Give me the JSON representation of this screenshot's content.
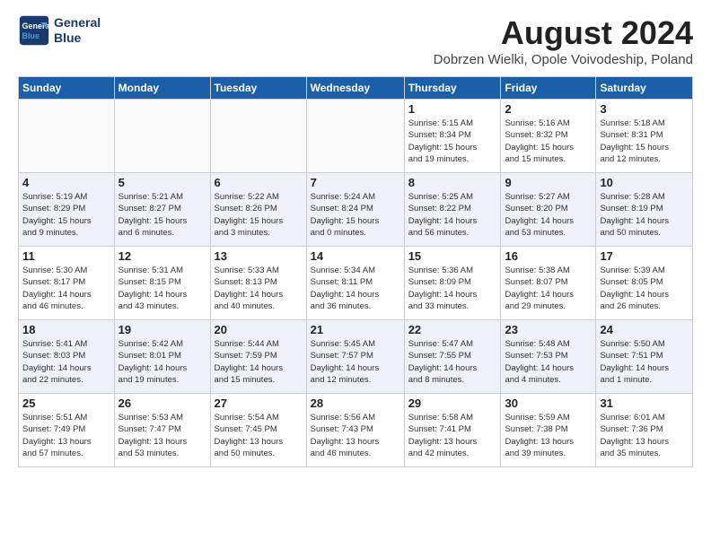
{
  "logo": {
    "line1": "General",
    "line2": "Blue"
  },
  "title": "August 2024",
  "location": "Dobrzen Wielki, Opole Voivodeship, Poland",
  "headers": [
    "Sunday",
    "Monday",
    "Tuesday",
    "Wednesday",
    "Thursday",
    "Friday",
    "Saturday"
  ],
  "weeks": [
    [
      {
        "day": "",
        "info": ""
      },
      {
        "day": "",
        "info": ""
      },
      {
        "day": "",
        "info": ""
      },
      {
        "day": "",
        "info": ""
      },
      {
        "day": "1",
        "info": "Sunrise: 5:15 AM\nSunset: 8:34 PM\nDaylight: 15 hours\nand 19 minutes."
      },
      {
        "day": "2",
        "info": "Sunrise: 5:16 AM\nSunset: 8:32 PM\nDaylight: 15 hours\nand 15 minutes."
      },
      {
        "day": "3",
        "info": "Sunrise: 5:18 AM\nSunset: 8:31 PM\nDaylight: 15 hours\nand 12 minutes."
      }
    ],
    [
      {
        "day": "4",
        "info": "Sunrise: 5:19 AM\nSunset: 8:29 PM\nDaylight: 15 hours\nand 9 minutes."
      },
      {
        "day": "5",
        "info": "Sunrise: 5:21 AM\nSunset: 8:27 PM\nDaylight: 15 hours\nand 6 minutes."
      },
      {
        "day": "6",
        "info": "Sunrise: 5:22 AM\nSunset: 8:26 PM\nDaylight: 15 hours\nand 3 minutes."
      },
      {
        "day": "7",
        "info": "Sunrise: 5:24 AM\nSunset: 8:24 PM\nDaylight: 15 hours\nand 0 minutes."
      },
      {
        "day": "8",
        "info": "Sunrise: 5:25 AM\nSunset: 8:22 PM\nDaylight: 14 hours\nand 56 minutes."
      },
      {
        "day": "9",
        "info": "Sunrise: 5:27 AM\nSunset: 8:20 PM\nDaylight: 14 hours\nand 53 minutes."
      },
      {
        "day": "10",
        "info": "Sunrise: 5:28 AM\nSunset: 8:19 PM\nDaylight: 14 hours\nand 50 minutes."
      }
    ],
    [
      {
        "day": "11",
        "info": "Sunrise: 5:30 AM\nSunset: 8:17 PM\nDaylight: 14 hours\nand 46 minutes."
      },
      {
        "day": "12",
        "info": "Sunrise: 5:31 AM\nSunset: 8:15 PM\nDaylight: 14 hours\nand 43 minutes."
      },
      {
        "day": "13",
        "info": "Sunrise: 5:33 AM\nSunset: 8:13 PM\nDaylight: 14 hours\nand 40 minutes."
      },
      {
        "day": "14",
        "info": "Sunrise: 5:34 AM\nSunset: 8:11 PM\nDaylight: 14 hours\nand 36 minutes."
      },
      {
        "day": "15",
        "info": "Sunrise: 5:36 AM\nSunset: 8:09 PM\nDaylight: 14 hours\nand 33 minutes."
      },
      {
        "day": "16",
        "info": "Sunrise: 5:38 AM\nSunset: 8:07 PM\nDaylight: 14 hours\nand 29 minutes."
      },
      {
        "day": "17",
        "info": "Sunrise: 5:39 AM\nSunset: 8:05 PM\nDaylight: 14 hours\nand 26 minutes."
      }
    ],
    [
      {
        "day": "18",
        "info": "Sunrise: 5:41 AM\nSunset: 8:03 PM\nDaylight: 14 hours\nand 22 minutes."
      },
      {
        "day": "19",
        "info": "Sunrise: 5:42 AM\nSunset: 8:01 PM\nDaylight: 14 hours\nand 19 minutes."
      },
      {
        "day": "20",
        "info": "Sunrise: 5:44 AM\nSunset: 7:59 PM\nDaylight: 14 hours\nand 15 minutes."
      },
      {
        "day": "21",
        "info": "Sunrise: 5:45 AM\nSunset: 7:57 PM\nDaylight: 14 hours\nand 12 minutes."
      },
      {
        "day": "22",
        "info": "Sunrise: 5:47 AM\nSunset: 7:55 PM\nDaylight: 14 hours\nand 8 minutes."
      },
      {
        "day": "23",
        "info": "Sunrise: 5:48 AM\nSunset: 7:53 PM\nDaylight: 14 hours\nand 4 minutes."
      },
      {
        "day": "24",
        "info": "Sunrise: 5:50 AM\nSunset: 7:51 PM\nDaylight: 14 hours\nand 1 minute."
      }
    ],
    [
      {
        "day": "25",
        "info": "Sunrise: 5:51 AM\nSunset: 7:49 PM\nDaylight: 13 hours\nand 57 minutes."
      },
      {
        "day": "26",
        "info": "Sunrise: 5:53 AM\nSunset: 7:47 PM\nDaylight: 13 hours\nand 53 minutes."
      },
      {
        "day": "27",
        "info": "Sunrise: 5:54 AM\nSunset: 7:45 PM\nDaylight: 13 hours\nand 50 minutes."
      },
      {
        "day": "28",
        "info": "Sunrise: 5:56 AM\nSunset: 7:43 PM\nDaylight: 13 hours\nand 46 minutes."
      },
      {
        "day": "29",
        "info": "Sunrise: 5:58 AM\nSunset: 7:41 PM\nDaylight: 13 hours\nand 42 minutes."
      },
      {
        "day": "30",
        "info": "Sunrise: 5:59 AM\nSunset: 7:38 PM\nDaylight: 13 hours\nand 39 minutes."
      },
      {
        "day": "31",
        "info": "Sunrise: 6:01 AM\nSunset: 7:36 PM\nDaylight: 13 hours\nand 35 minutes."
      }
    ]
  ]
}
